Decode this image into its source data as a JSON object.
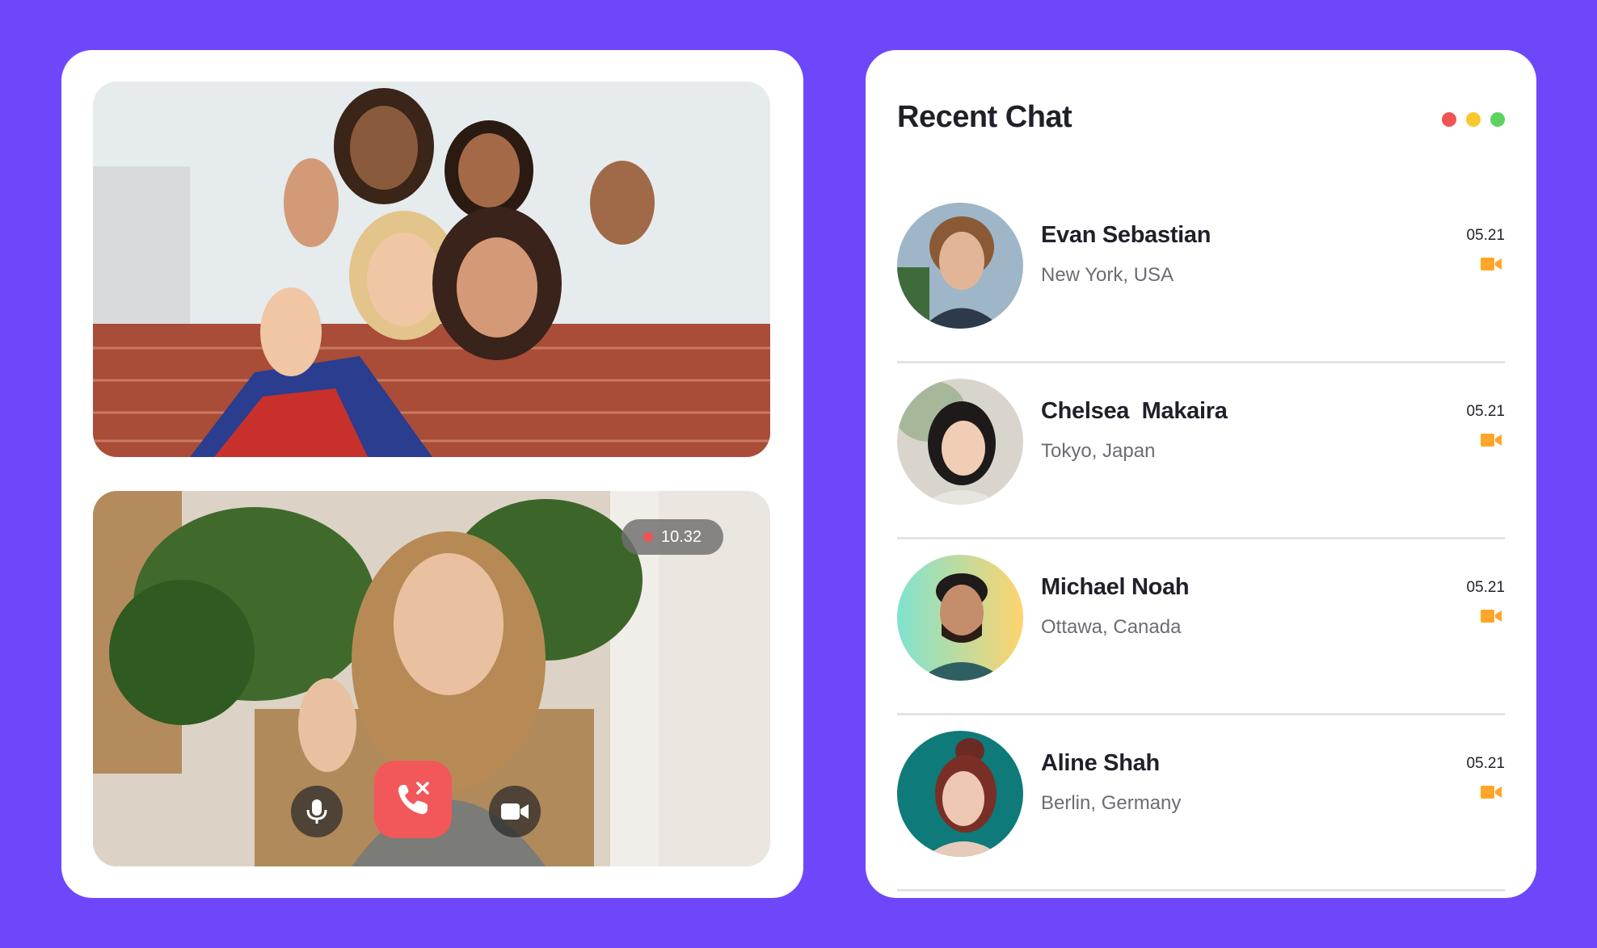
{
  "recording": {
    "time": "10.32",
    "dot_color": "#f05454"
  },
  "call_controls": {
    "mic_icon": "microphone-icon",
    "end_icon": "end-call-icon",
    "camera_icon": "video-camera-icon",
    "end_color": "#f2575a"
  },
  "chat": {
    "title": "Recent Chat",
    "window_dots": [
      "#f05454",
      "#f9c82d",
      "#5dd35f"
    ],
    "accent": "#ffa62b",
    "items": [
      {
        "name": "Evan Sebastian",
        "location": "New York, USA",
        "time": "05.21"
      },
      {
        "name": "Chelsea  Makaira",
        "location": "Tokyo, Japan",
        "time": "05.21"
      },
      {
        "name": "Michael Noah",
        "location": "Ottawa, Canada",
        "time": "05.21"
      },
      {
        "name": "Aline Shah",
        "location": "Berlin, Germany",
        "time": "05.21"
      }
    ]
  },
  "colors": {
    "background": "#6f47fb",
    "card": "#ffffff"
  }
}
